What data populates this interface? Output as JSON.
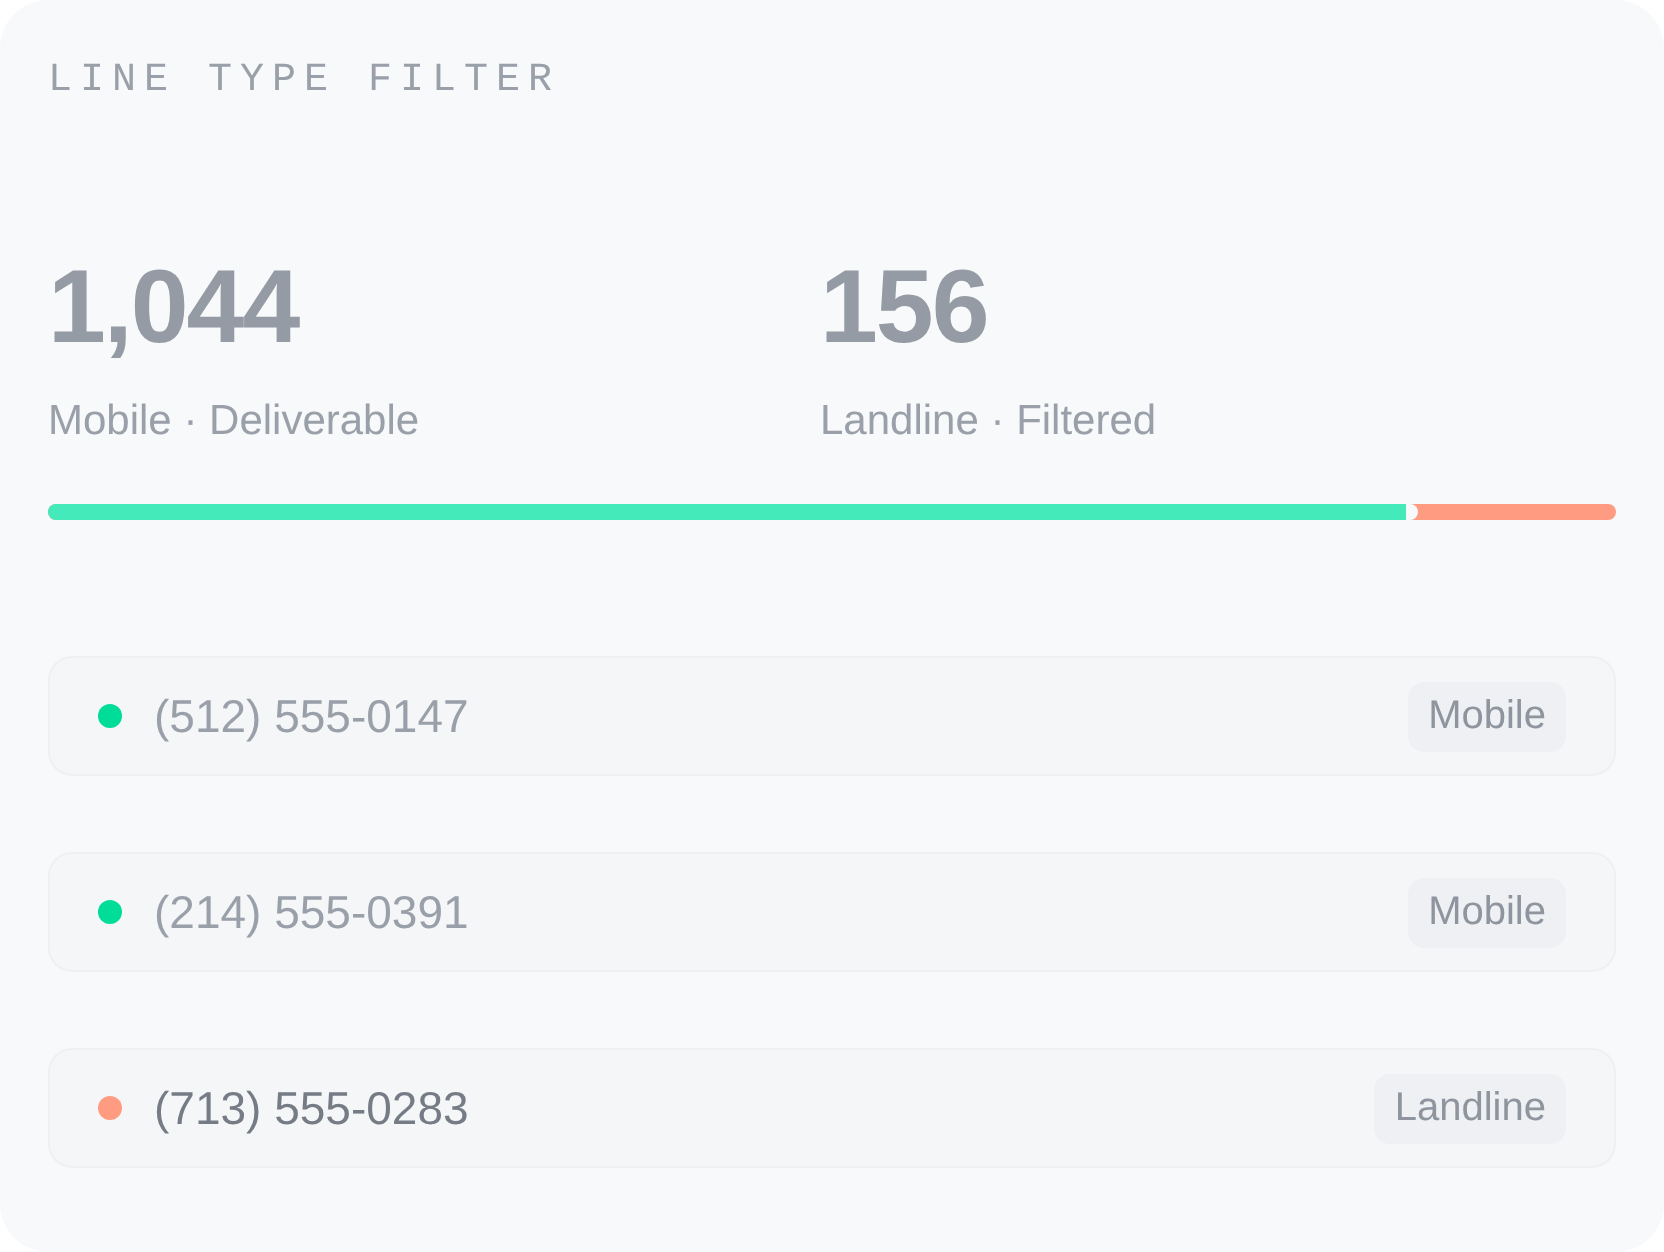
{
  "title": "LINE TYPE FILTER",
  "stats": [
    {
      "value": "1,044",
      "label": "Mobile · Deliverable"
    },
    {
      "value": "156",
      "label": "Landline · Filtered"
    }
  ],
  "split_bar": {
    "level": 0.87
  },
  "numbers": [
    {
      "phone": "(512) 555-0147",
      "color": "#00dd99",
      "filtered": false,
      "type": "Mobile"
    },
    {
      "phone": "(214) 555-0391",
      "color": "#00dd99",
      "filtered": false,
      "type": "Mobile"
    },
    {
      "phone": "(713) 555-0283",
      "color": "#ff9b80",
      "filtered": true,
      "type": "Landline"
    }
  ]
}
